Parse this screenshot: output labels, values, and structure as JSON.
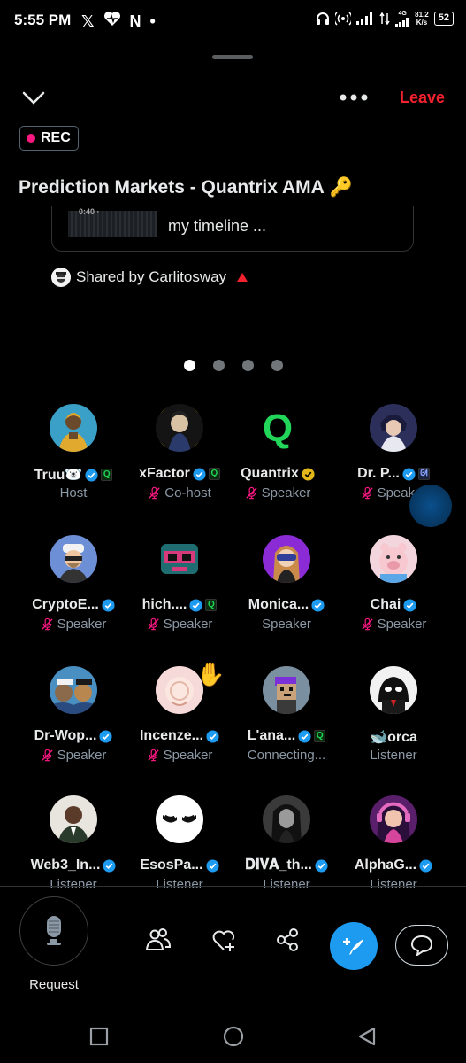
{
  "status": {
    "time": "5:55 PM",
    "left_icons": [
      "x-logo-icon",
      "heart-pulse-icon",
      "n-icon",
      "dot-icon"
    ],
    "net_type": "4G",
    "speed_value": "81.2",
    "speed_unit": "K/s",
    "battery": "52"
  },
  "header": {
    "leave_label": "Leave",
    "rec_label": "REC",
    "title": "Prediction Markets - Quantrix AMA",
    "title_emoji": "🔑"
  },
  "shared_post": {
    "thumb_text": "0:40 ·",
    "text": "my timeline ...",
    "shared_by": "Shared by Carlitosway"
  },
  "pager": {
    "count": 4,
    "active_index": 0
  },
  "participants": [
    {
      "name": "Truu🐻‍❄️",
      "role": "Host",
      "verified": true,
      "q": true,
      "muted": false
    },
    {
      "name": "xFactor",
      "role": "Co-host",
      "verified": true,
      "q": true,
      "muted": true
    },
    {
      "name": "Quantrix",
      "role": "Speaker",
      "verified_gold": true,
      "muted": true
    },
    {
      "name": "Dr. P...",
      "role": "Speaker",
      "verified": true,
      "badge2": true,
      "muted": true
    },
    {
      "name": "CryptoE...",
      "role": "Speaker",
      "verified": true,
      "muted": true
    },
    {
      "name": "hich....",
      "role": "Speaker",
      "verified": true,
      "q": true,
      "muted": true
    },
    {
      "name": "Monica...",
      "role": "Speaker",
      "verified": true,
      "muted": false
    },
    {
      "name": "Chai",
      "role": "Speaker",
      "verified": true,
      "muted": true
    },
    {
      "name": "Dr-Wop...",
      "role": "Speaker",
      "verified": true,
      "muted": true
    },
    {
      "name": "Incenze...",
      "role": "Speaker",
      "verified": true,
      "muted": true,
      "hand": "✋"
    },
    {
      "name": "L'ana...",
      "role": "Connecting...",
      "verified": true,
      "q": true,
      "muted": false
    },
    {
      "name": "🐋orca",
      "role": "Listener",
      "muted": false
    },
    {
      "name": "Web3_In...",
      "role": "Listener",
      "verified": true,
      "muted": false
    },
    {
      "name": "EsosPa...",
      "role": "Listener",
      "verified": true,
      "muted": false
    },
    {
      "name": "𝐃𝐈𝐕𝐀_th...",
      "role": "Listener",
      "verified": true,
      "muted": false
    },
    {
      "name": "AlphaG...",
      "role": "Listener",
      "verified": true,
      "muted": false
    }
  ],
  "bottom": {
    "request_label": "Request",
    "tools": [
      "people-icon",
      "heart-plus-icon",
      "share-icon",
      "compose-icon",
      "comment-icon"
    ]
  },
  "colors": {
    "accent": "#1d9bf0",
    "leave": "#f4212e",
    "rec_dot": "#f91880",
    "muted": "#f91880",
    "gold": "#e2b719"
  }
}
